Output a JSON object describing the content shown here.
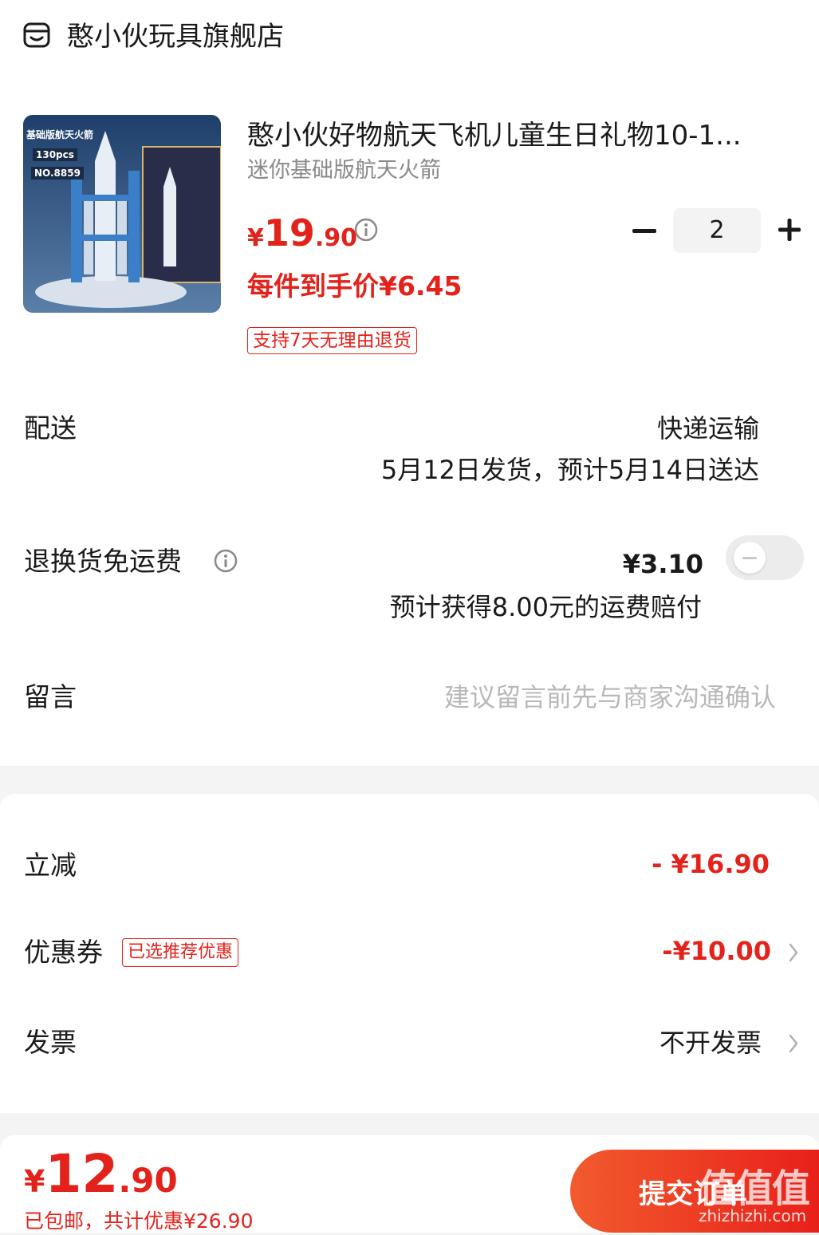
{
  "store": {
    "name": "憨小伙玩具旗舰店",
    "icon": "store-icon"
  },
  "product": {
    "image_labels": {
      "edition": "基础版航天火箭",
      "pieces": "130pcs",
      "model_no": "NO.8859"
    },
    "title": "憨小伙好物航天飞机儿童生日礼物10-1...",
    "spec": "迷你基础版航天火箭",
    "price": {
      "currency": "¥",
      "integer": "19",
      "decimal": ".90"
    },
    "per_item_price": "每件到手价¥6.45",
    "return_policy": "支持7天无理由退货",
    "quantity": "2"
  },
  "delivery": {
    "label": "配送",
    "method": "快递运输",
    "schedule": "5月12日发货，预计5月14日送达"
  },
  "return_shipping": {
    "label": "退换货免运费",
    "price": "¥3.10",
    "compensation": "预计获得8.00元的运费赔付",
    "toggle_on": false
  },
  "message": {
    "label": "留言",
    "placeholder": "建议留言前先与商家沟通确认"
  },
  "discount": {
    "label": "立减",
    "value": "- ¥16.90"
  },
  "coupon": {
    "label": "优惠券",
    "tag": "已选推荐优惠",
    "value": "-¥10.00"
  },
  "invoice": {
    "label": "发票",
    "value": "不开发票"
  },
  "footer": {
    "total": {
      "currency": "¥",
      "integer": "12",
      "decimal": ".90"
    },
    "summary": "已包邮，共计优惠¥26.90",
    "submit_label": "提交订单",
    "watermark": "值值值",
    "watermark_url": "zhizhizhi.com"
  },
  "colors": {
    "accent_red": "#e3231b",
    "button_start": "#f25b2e",
    "button_end": "#e8201a"
  }
}
